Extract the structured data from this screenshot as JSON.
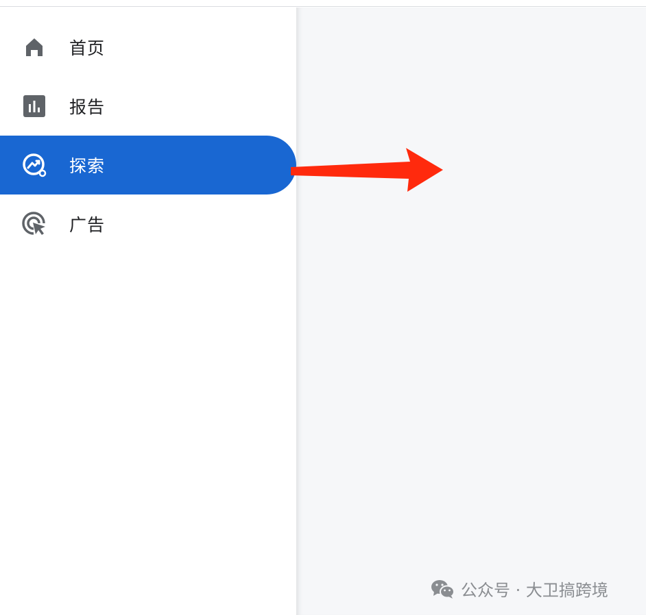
{
  "nav": {
    "items": [
      {
        "label": "首页",
        "icon": "home-icon"
      },
      {
        "label": "报告",
        "icon": "bar-chart-icon"
      },
      {
        "label": "探索",
        "icon": "explore-icon",
        "active": true
      },
      {
        "label": "广告",
        "icon": "ads-icon"
      }
    ]
  },
  "watermark": {
    "text": "公众号 · 大卫搞跨境",
    "icon": "wechat-icon"
  },
  "colors": {
    "active_bg": "#1967d2",
    "icon_gray": "#5f6368",
    "arrow": "#ff2a0d",
    "content_bg": "#f6f7f9"
  }
}
